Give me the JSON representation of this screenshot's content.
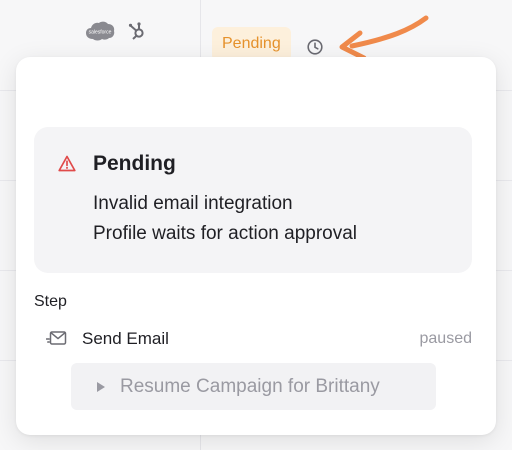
{
  "row": {
    "status_label": "Pending",
    "icons": [
      "salesforce-icon",
      "hubspot-icon",
      "clock-icon"
    ],
    "salesforce_text": "salesforce"
  },
  "popover": {
    "alert": {
      "icon": "warning-triangle-icon",
      "title": "Pending",
      "lines": [
        "Invalid email integration",
        "Profile waits for action approval"
      ]
    },
    "step_heading": "Step",
    "step": {
      "icon": "email-send-icon",
      "label": "Send Email",
      "status": "paused"
    },
    "resume_button": {
      "icon": "play-icon",
      "label": "Resume Campaign for Brittany"
    }
  },
  "colors": {
    "pending_text": "#e6922c",
    "pending_bg": "#fdf0dc",
    "warning": "#e04a4a",
    "annotation_arrow": "#f08a4b"
  }
}
